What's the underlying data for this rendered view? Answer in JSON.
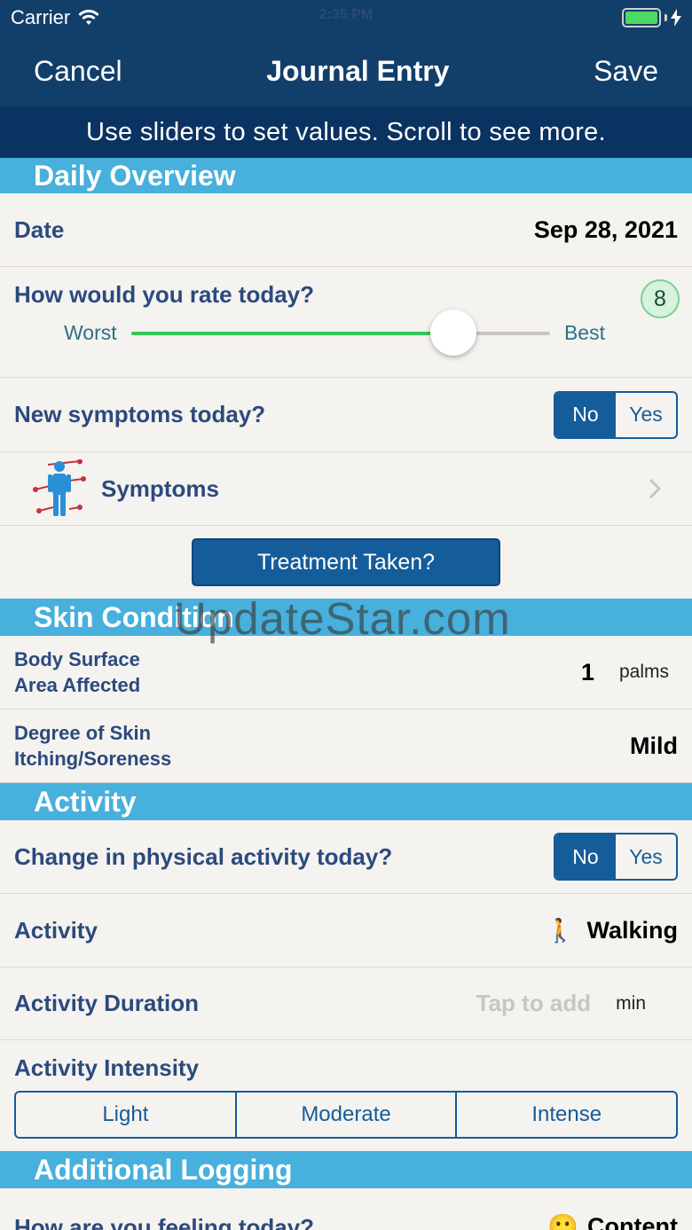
{
  "status": {
    "carrier": "Carrier",
    "time": "2:35 PM"
  },
  "nav": {
    "cancel": "Cancel",
    "title": "Journal Entry",
    "save": "Save"
  },
  "hint": "Use sliders to set values. Scroll to see more.",
  "daily": {
    "header": "Daily Overview",
    "date_label": "Date",
    "date_value": "Sep 28, 2021",
    "rate_label": "How would you rate today?",
    "rate_value": "8",
    "rate_fraction": 0.77,
    "worst": "Worst",
    "best": "Best",
    "new_symptoms_label": "New symptoms today?",
    "no": "No",
    "yes": "Yes",
    "symptoms_label": "Symptoms",
    "treatment_button": "Treatment Taken?"
  },
  "skin": {
    "header": "Skin Condition",
    "bsa_label_1": "Body Surface",
    "bsa_label_2": "Area Affected",
    "bsa_value": "1",
    "bsa_unit": "palms",
    "itch_label_1": "Degree of Skin",
    "itch_label_2": "Itching/Soreness",
    "itch_value": "Mild"
  },
  "activity": {
    "header": "Activity",
    "change_label": "Change in physical activity today?",
    "no": "No",
    "yes": "Yes",
    "activity_label": "Activity",
    "activity_icon": "🚶",
    "activity_value": "Walking",
    "duration_label": "Activity Duration",
    "duration_placeholder": "Tap to add",
    "duration_unit": "min",
    "intensity_label": "Activity Intensity",
    "intensity_options": [
      "Light",
      "Moderate",
      "Intense"
    ]
  },
  "additional": {
    "header": "Additional Logging",
    "feeling_label": "How are you feeling today?",
    "feeling_icon": "🙂",
    "feeling_value": "Content"
  },
  "watermark": "UpdateStar.com",
  "colors": {
    "navy": "#123e6a",
    "section": "#47b0dc",
    "accent": "#155c9a",
    "slider_fill": "#34c759"
  }
}
